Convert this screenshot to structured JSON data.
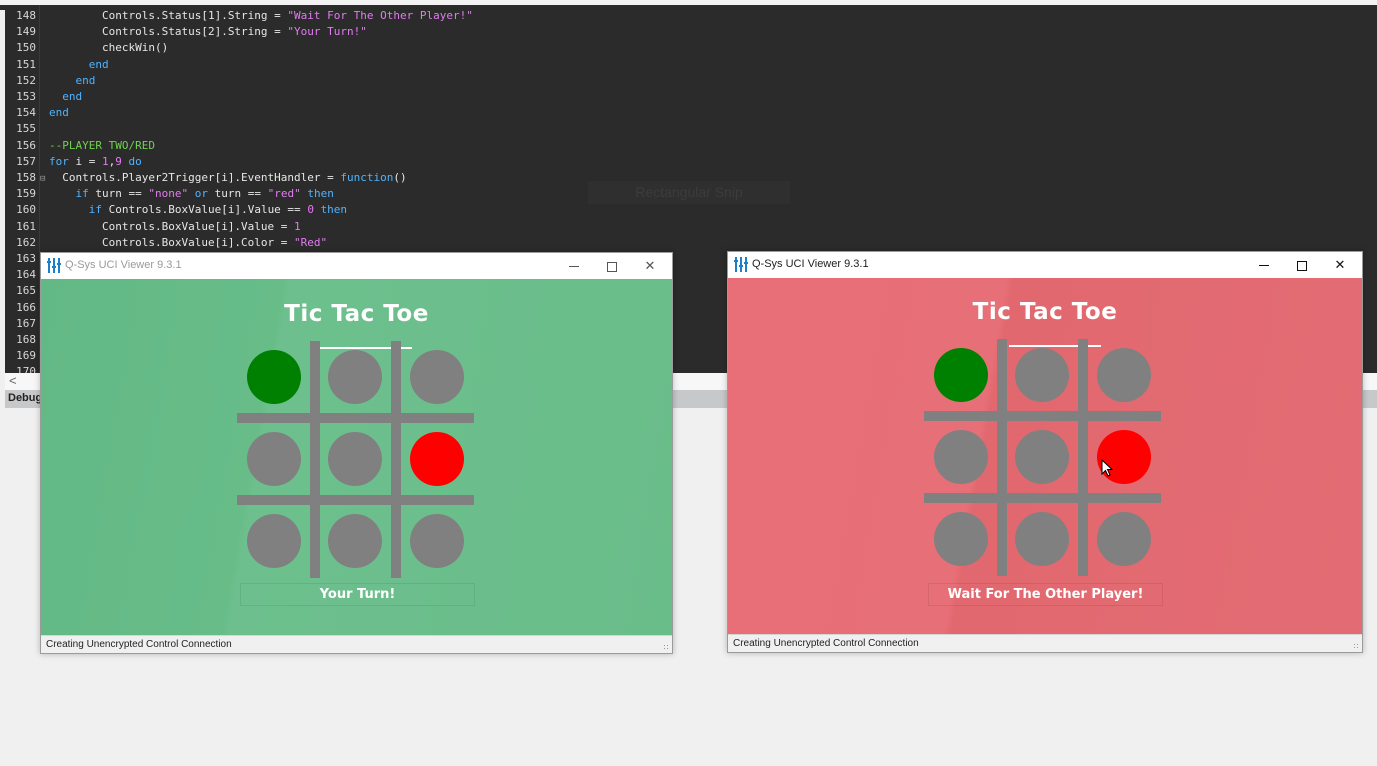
{
  "editor": {
    "lines": [
      {
        "n": "148",
        "indent": 4,
        "tokens": [
          {
            "t": "tx",
            "v": "Controls.Status[1].String = "
          },
          {
            "t": "st",
            "v": "\"Wait For The Other Player!\""
          }
        ]
      },
      {
        "n": "149",
        "indent": 4,
        "tokens": [
          {
            "t": "tx",
            "v": "Controls.Status[2].String = "
          },
          {
            "t": "st",
            "v": "\"Your Turn!\""
          }
        ]
      },
      {
        "n": "150",
        "indent": 4,
        "tokens": [
          {
            "t": "tx",
            "v": "checkWin()"
          }
        ]
      },
      {
        "n": "151",
        "indent": 3,
        "tokens": [
          {
            "t": "kw",
            "v": "end"
          }
        ]
      },
      {
        "n": "152",
        "indent": 2,
        "tokens": [
          {
            "t": "kw",
            "v": "end"
          }
        ]
      },
      {
        "n": "153",
        "indent": 1,
        "tokens": [
          {
            "t": "kw",
            "v": "end"
          }
        ]
      },
      {
        "n": "154",
        "indent": 0,
        "tokens": [
          {
            "t": "kw",
            "v": "end"
          }
        ]
      },
      {
        "n": "155",
        "indent": 0,
        "tokens": []
      },
      {
        "n": "156",
        "indent": 0,
        "tokens": [
          {
            "t": "cm",
            "v": "--PLAYER TWO/RED"
          }
        ]
      },
      {
        "n": "157",
        "indent": 0,
        "tokens": [
          {
            "t": "kw",
            "v": "for"
          },
          {
            "t": "tx",
            "v": " i = "
          },
          {
            "t": "nm",
            "v": "1"
          },
          {
            "t": "tx",
            "v": ","
          },
          {
            "t": "nm",
            "v": "9"
          },
          {
            "t": "tx",
            "v": " "
          },
          {
            "t": "kw",
            "v": "do"
          }
        ]
      },
      {
        "n": "158",
        "indent": 1,
        "fold": true,
        "tokens": [
          {
            "t": "tx",
            "v": "Controls.Player2Trigger[i].EventHandler = "
          },
          {
            "t": "kw",
            "v": "function"
          },
          {
            "t": "tx",
            "v": "()"
          }
        ]
      },
      {
        "n": "159",
        "indent": 2,
        "tokens": [
          {
            "t": "kw",
            "v": "if"
          },
          {
            "t": "tx",
            "v": " turn == "
          },
          {
            "t": "st",
            "v": "\"none\""
          },
          {
            "t": "tx",
            "v": " "
          },
          {
            "t": "kw",
            "v": "or"
          },
          {
            "t": "tx",
            "v": " turn == "
          },
          {
            "t": "st",
            "v": "\"red\""
          },
          {
            "t": "tx",
            "v": " "
          },
          {
            "t": "kw",
            "v": "then"
          }
        ]
      },
      {
        "n": "160",
        "indent": 3,
        "tokens": [
          {
            "t": "kw",
            "v": "if"
          },
          {
            "t": "tx",
            "v": " Controls.BoxValue[i].Value == "
          },
          {
            "t": "nm",
            "v": "0"
          },
          {
            "t": "tx",
            "v": " "
          },
          {
            "t": "kw",
            "v": "then"
          }
        ]
      },
      {
        "n": "161",
        "indent": 4,
        "tokens": [
          {
            "t": "tx",
            "v": "Controls.BoxValue[i].Value = "
          },
          {
            "t": "nm",
            "v": "1"
          }
        ]
      },
      {
        "n": "162",
        "indent": 4,
        "tokens": [
          {
            "t": "tx",
            "v": "Controls.BoxValue[i].Color = "
          },
          {
            "t": "st",
            "v": "\"Red\""
          }
        ]
      },
      {
        "n": "163",
        "indent": 0,
        "tokens": []
      },
      {
        "n": "164",
        "indent": 0,
        "tokens": []
      },
      {
        "n": "165",
        "indent": 0,
        "tokens": []
      },
      {
        "n": "166",
        "indent": 0,
        "tokens": []
      },
      {
        "n": "167",
        "indent": 0,
        "tokens": []
      },
      {
        "n": "168",
        "indent": 0,
        "tokens": []
      },
      {
        "n": "169",
        "indent": 0,
        "tokens": []
      },
      {
        "n": "170",
        "indent": 0,
        "tokens": []
      }
    ],
    "snip_overlay": "Rectangular Snip",
    "scroll_left": "<",
    "debug_tab": "Debug"
  },
  "windows": [
    {
      "id": "player1",
      "title": "Q-Sys UCI Viewer 9.3.1",
      "active": false,
      "theme": "green",
      "game_title": "Tic Tac Toe",
      "board": [
        "green",
        "empty",
        "empty",
        "empty",
        "empty",
        "red",
        "empty",
        "empty",
        "empty"
      ],
      "status": "Your Turn!",
      "statusbar": "Creating Unencrypted Control Connection"
    },
    {
      "id": "player2",
      "title": "Q-Sys UCI Viewer 9.3.1",
      "active": true,
      "theme": "red",
      "game_title": "Tic Tac Toe",
      "board": [
        "green",
        "empty",
        "empty",
        "empty",
        "empty",
        "red",
        "empty",
        "empty",
        "empty"
      ],
      "status": "Wait For The Other Player!",
      "statusbar": "Creating Unencrypted Control Connection"
    }
  ],
  "colors": {
    "green_theme": "#67bc88",
    "red_theme": "#e46d75",
    "piece_green": "#008000",
    "piece_red": "#ff0000",
    "piece_empty": "#808080",
    "grid": "#808080"
  }
}
